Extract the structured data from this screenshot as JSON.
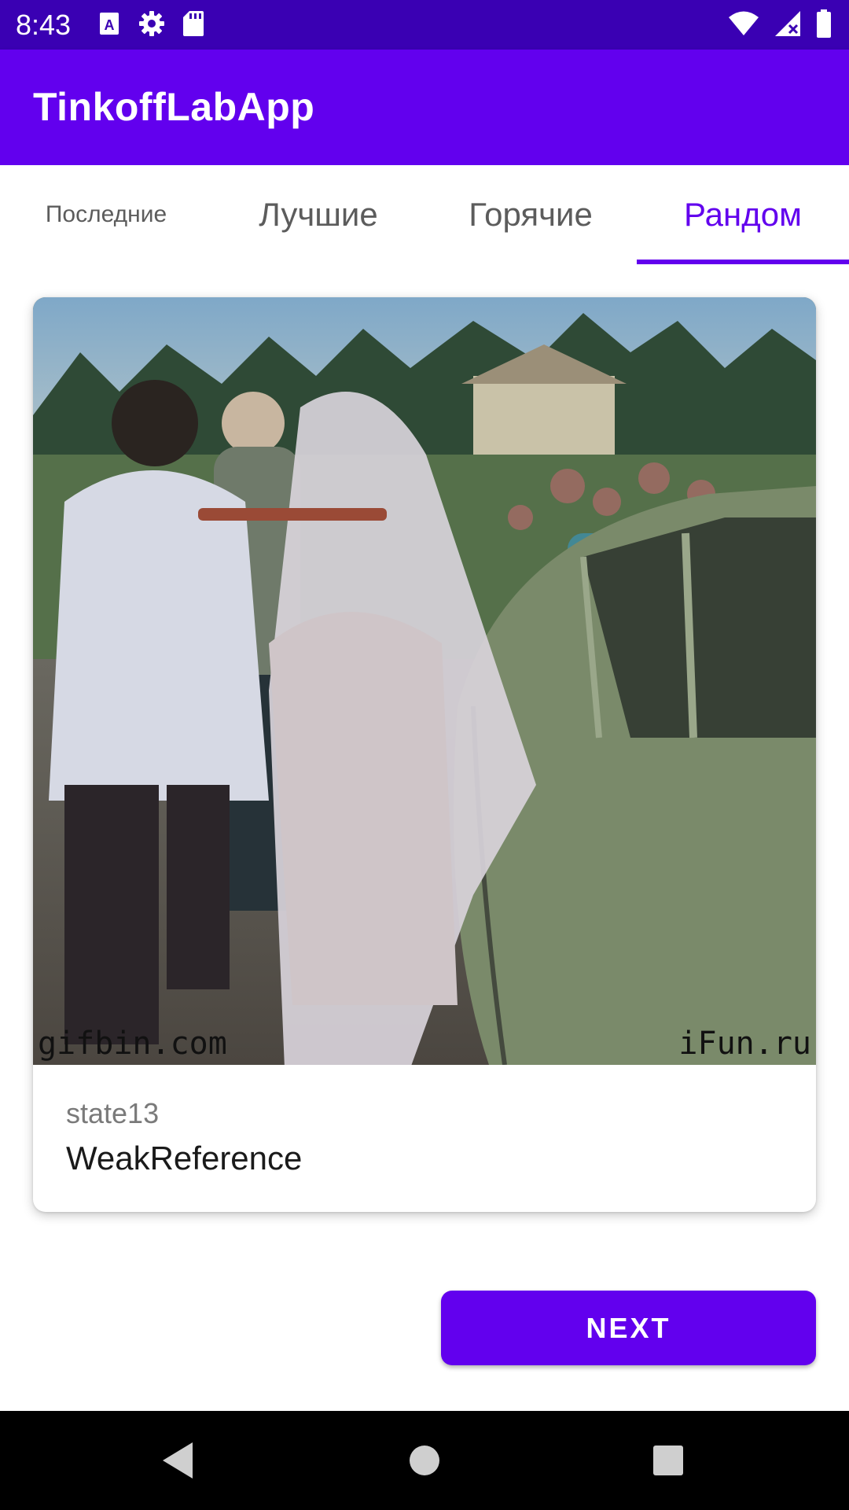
{
  "status_bar": {
    "time": "8:43",
    "icons": [
      "keyboard-a-icon",
      "settings-gear-icon",
      "sd-card-icon",
      "wifi-icon",
      "signal-icon",
      "battery-icon"
    ]
  },
  "app_bar": {
    "title": "TinkoffLabApp"
  },
  "tabs": [
    {
      "label": "Последние",
      "selected": false
    },
    {
      "label": "Лучшие",
      "selected": false
    },
    {
      "label": "Горячие",
      "selected": false
    },
    {
      "label": "Рандом",
      "selected": true
    }
  ],
  "post": {
    "watermark_left": "gifbin.com",
    "watermark_right": "iFun.ru",
    "author": "state13",
    "description": "WeakReference"
  },
  "actions": {
    "next_label": "NEXT"
  },
  "nav": {
    "icons": [
      "back-icon",
      "home-icon",
      "recents-icon"
    ]
  },
  "colors": {
    "status_bar": "#3a00b3",
    "primary": "#6200ee",
    "nav_bar": "#000000"
  }
}
